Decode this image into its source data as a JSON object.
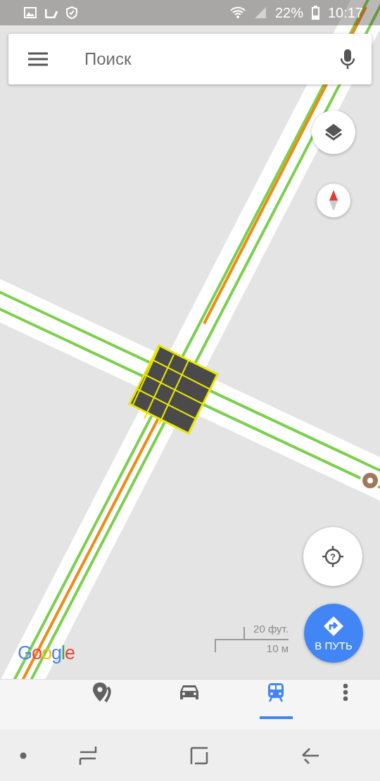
{
  "status_bar": {
    "battery": "22%",
    "time": "10:17"
  },
  "search": {
    "placeholder": "Поиск"
  },
  "map": {
    "kind": "picture",
    "scale": {
      "imperial": "20 фут.",
      "metric": "10 м"
    },
    "logo": "Google"
  },
  "location_button": {
    "symbol": "?"
  },
  "go_button": {
    "label": "В ПУТЬ"
  },
  "tabs": [
    {
      "kind": "explore",
      "selected": false
    },
    {
      "kind": "driving",
      "selected": false
    },
    {
      "kind": "transit",
      "selected": true
    }
  ]
}
